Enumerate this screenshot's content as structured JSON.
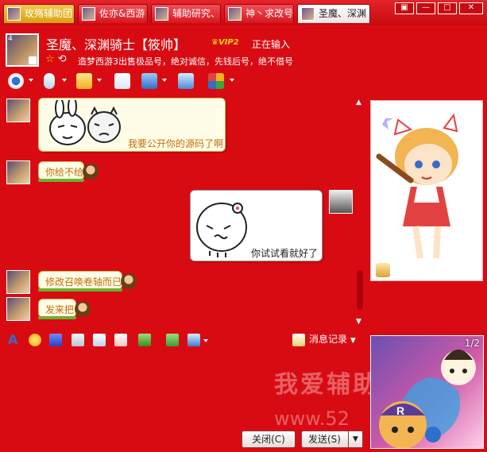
{
  "tabs": [
    {
      "label": "玫殇辅助团",
      "state": "first"
    },
    {
      "label": "佐亦&西游",
      "state": "normal"
    },
    {
      "label": "辅助研究、",
      "state": "normal"
    },
    {
      "label": "神丶求改号",
      "state": "normal"
    },
    {
      "label": "圣魔、深渊",
      "state": "active"
    }
  ],
  "window_controls": [
    "▣",
    "—",
    "□",
    "✕"
  ],
  "contact": {
    "name": "圣魔、深渊骑士【筱帅】",
    "vip": "VIP2",
    "status": "正在输入",
    "signature": "造梦西游3出售极品号，绝对诚信，先钱后号，绝不借号",
    "level": "4"
  },
  "messages": [
    {
      "from": "them",
      "text": "我要公开你的源码了啊"
    },
    {
      "from": "them",
      "text": "你给不给"
    },
    {
      "from": "me",
      "text": "你试试看就好了"
    },
    {
      "from": "them",
      "text": "修改召唤卷轴而已"
    },
    {
      "from": "them",
      "text": "发来把"
    }
  ],
  "input_toolbar": {
    "history_label": "消息记录"
  },
  "buttons": {
    "close": "关闭(C)",
    "send": "发送(S)"
  },
  "watermark": {
    "line1": "我爱辅助",
    "line2": "www.52"
  },
  "ad": {
    "page": "1/2"
  },
  "colors": {
    "window_bg": "#d90b12",
    "bubble_in_text": "#c86d0a"
  }
}
